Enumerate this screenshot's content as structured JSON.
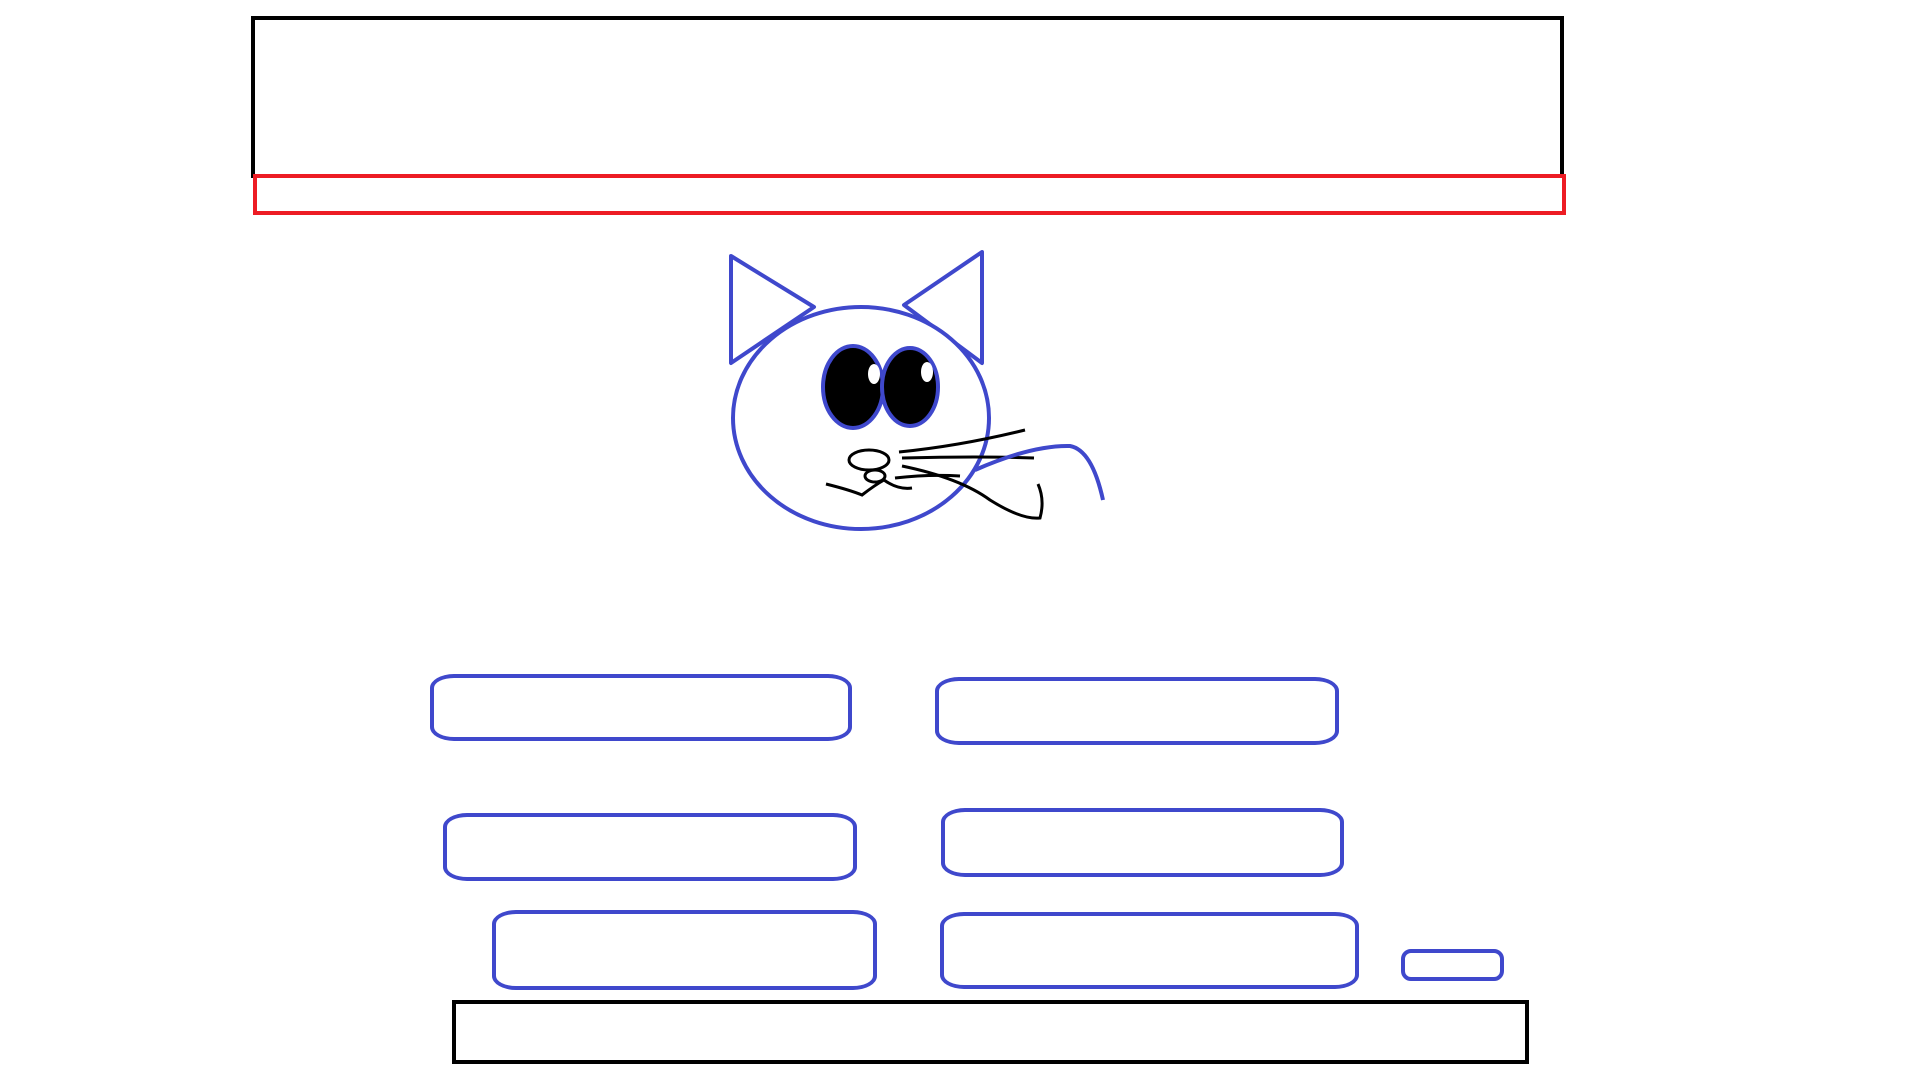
{
  "colors": {
    "outline": "#000000",
    "nav_outline": "#ed1c24",
    "accent": "#3f48cc",
    "background": "#ffffff"
  },
  "header": {
    "title": ""
  },
  "nav_bar": {
    "label": ""
  },
  "mascot": {
    "icon": "cat-icon"
  },
  "menu_buttons": [
    {
      "label": ""
    },
    {
      "label": ""
    },
    {
      "label": ""
    },
    {
      "label": ""
    },
    {
      "label": ""
    },
    {
      "label": ""
    }
  ],
  "small_button": {
    "label": ""
  },
  "footer": {
    "text": ""
  }
}
